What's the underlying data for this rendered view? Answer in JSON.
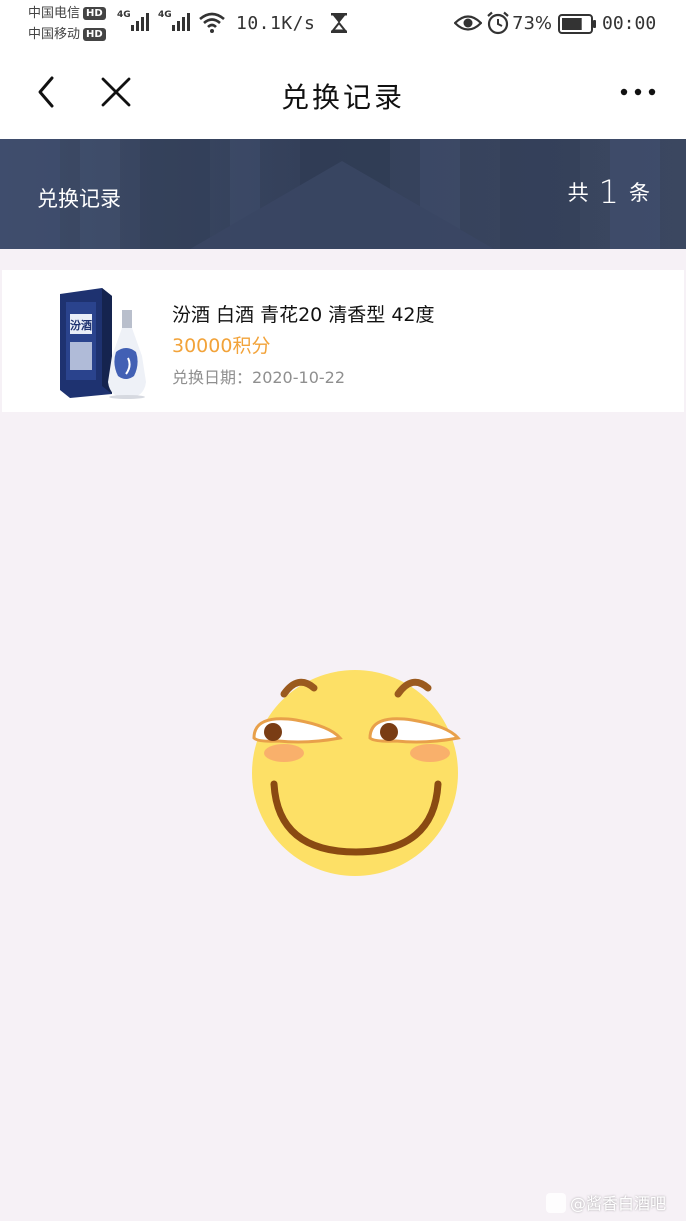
{
  "status_bar": {
    "carrier_1": "中国电信",
    "carrier_2": "中国移动",
    "hd_label": "HD",
    "network_tag_1": "4G",
    "network_tag_2": "4G",
    "net_speed": "10.1K/s",
    "battery_percent": "73%",
    "battery_level": 0.73,
    "time": "00:00"
  },
  "nav": {
    "title": "兑换记录",
    "icons": [
      "back-icon",
      "close-icon",
      "more-icon"
    ]
  },
  "summary": {
    "label": "兑换记录",
    "count_prefix": "共",
    "count": "1",
    "count_suffix": "条"
  },
  "records": [
    {
      "name": "汾酒 白酒 青花20 清香型 42度",
      "points": "30000积分",
      "date_label": "兑换日期：",
      "date": "2020-10-22",
      "image_text": "汾酒"
    }
  ],
  "watermark": {
    "text": "@酱香白酒吧"
  },
  "colors": {
    "accent_points": "#f2a33a",
    "banner_bg": "#3d4b66",
    "page_bg": "#f6f1f6"
  }
}
